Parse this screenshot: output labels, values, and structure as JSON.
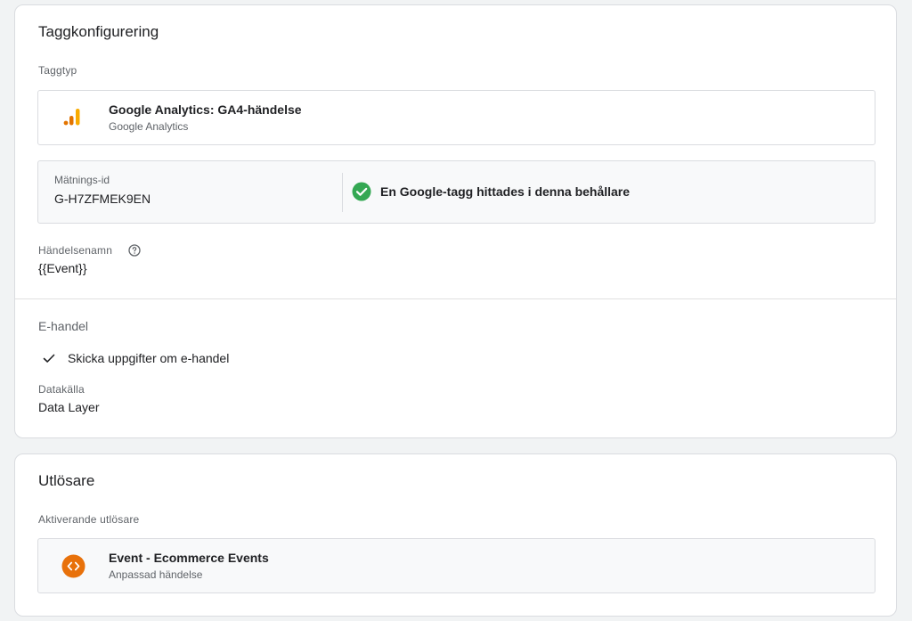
{
  "tag_config": {
    "title": "Taggkonfigurering",
    "tag_type_label": "Taggtyp",
    "tag_type": {
      "name": "Google Analytics: GA4-händelse",
      "sub": "Google Analytics",
      "icon": "analytics-bars-icon",
      "colors": [
        "#e37400",
        "#f9ab00"
      ]
    },
    "measurement": {
      "label": "Mätnings-id",
      "value": "G-H7ZFMEK9EN",
      "status": "En Google-tagg hittades i denna behållare",
      "status_icon": "check-circle-icon",
      "status_color": "#34a853"
    },
    "event_name": {
      "label": "Händelsenamn",
      "value": "{{Event}}",
      "help_icon": "help-circle-icon"
    },
    "ecommerce": {
      "title": "E-handel",
      "check_label": "Skicka uppgifter om e-handel",
      "checked": true,
      "data_source_label": "Datakälla",
      "data_source_value": "Data Layer"
    }
  },
  "triggering": {
    "title": "Utlösare",
    "label": "Aktiverande utlösare",
    "trigger": {
      "name": "Event - Ecommerce Events",
      "sub": "Anpassad händelse",
      "icon": "custom-event-code-icon",
      "icon_color": "#e8710a"
    }
  }
}
